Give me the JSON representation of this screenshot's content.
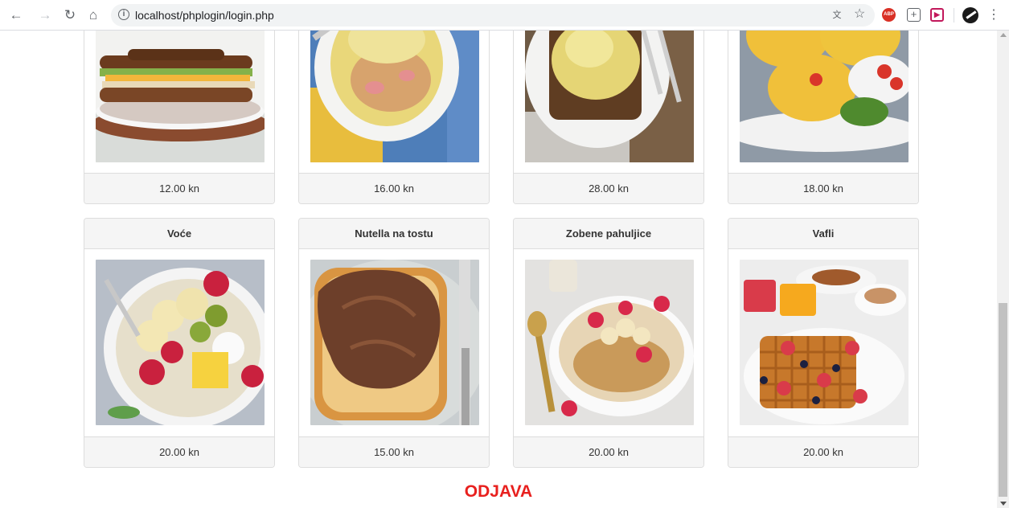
{
  "browser": {
    "url": "localhost/phplogin/login.php",
    "icons": [
      "back-icon",
      "forward-icon",
      "reload-icon",
      "home-icon",
      "info-icon",
      "translate-icon",
      "star-icon",
      "adblock-plus-icon",
      "add-extension-icon",
      "red-extension-icon",
      "profile-avatar-icon",
      "kebab-menu-icon"
    ]
  },
  "products_top": [
    {
      "price": "12.00 kn",
      "image": "sandwich"
    },
    {
      "price": "16.00 kn",
      "image": "omelette"
    },
    {
      "price": "28.00 kn",
      "image": "egg-salad-toast"
    },
    {
      "price": "18.00 kn",
      "image": "egg-muffins"
    }
  ],
  "products_bottom": [
    {
      "name": "Voće",
      "price": "20.00 kn",
      "image": "fruit-bowl"
    },
    {
      "name": "Nutella na tostu",
      "price": "15.00 kn",
      "image": "nutella-toast"
    },
    {
      "name": "Zobene pahuljice",
      "price": "20.00 kn",
      "image": "oatmeal-bowl"
    },
    {
      "name": "Vafli",
      "price": "20.00 kn",
      "image": "waffles"
    }
  ],
  "logout_label": "ODJAVA",
  "colors": {
    "logout": "#e8201e",
    "panel_bg": "#f5f5f5",
    "border": "#dddddd"
  }
}
